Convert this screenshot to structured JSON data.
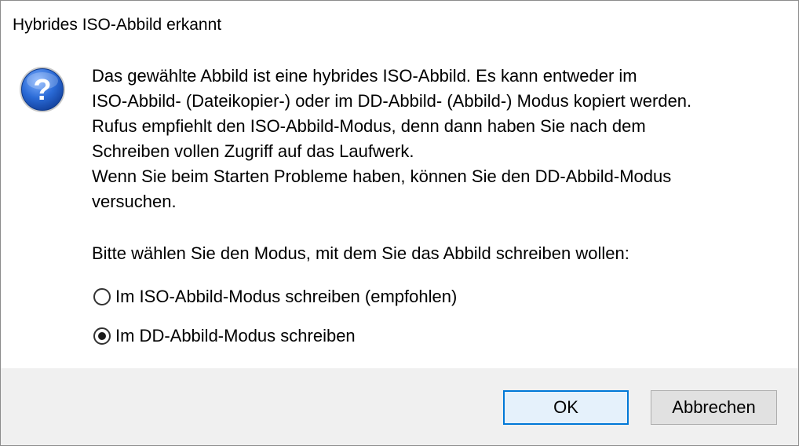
{
  "dialog": {
    "title": "Hybrides ISO-Abbild erkannt",
    "icon": "question-icon",
    "message_lines": [
      "Das gewählte Abbild ist eine hybrides ISO-Abbild. Es kann entweder im",
      "ISO-Abbild- (Dateikopier-) oder im DD-Abbild- (Abbild-) Modus kopiert werden.",
      "Rufus empfiehlt den ISO-Abbild-Modus, denn dann haben Sie nach dem",
      "Schreiben vollen Zugriff auf das Laufwerk.",
      "Wenn Sie beim Starten Probleme haben, können Sie den DD-Abbild-Modus",
      "versuchen."
    ],
    "prompt": "Bitte wählen Sie den Modus, mit dem Sie das Abbild schreiben wollen:",
    "options": [
      {
        "label": "Im ISO-Abbild-Modus schreiben (empfohlen)",
        "selected": false
      },
      {
        "label": "Im DD-Abbild-Modus schreiben",
        "selected": true
      }
    ],
    "buttons": {
      "ok": "OK",
      "cancel": "Abbrechen"
    },
    "colors": {
      "accent": "#0078d7",
      "footer_bg": "#f0f0f0",
      "icon_blue": "#1e5fc8"
    }
  }
}
